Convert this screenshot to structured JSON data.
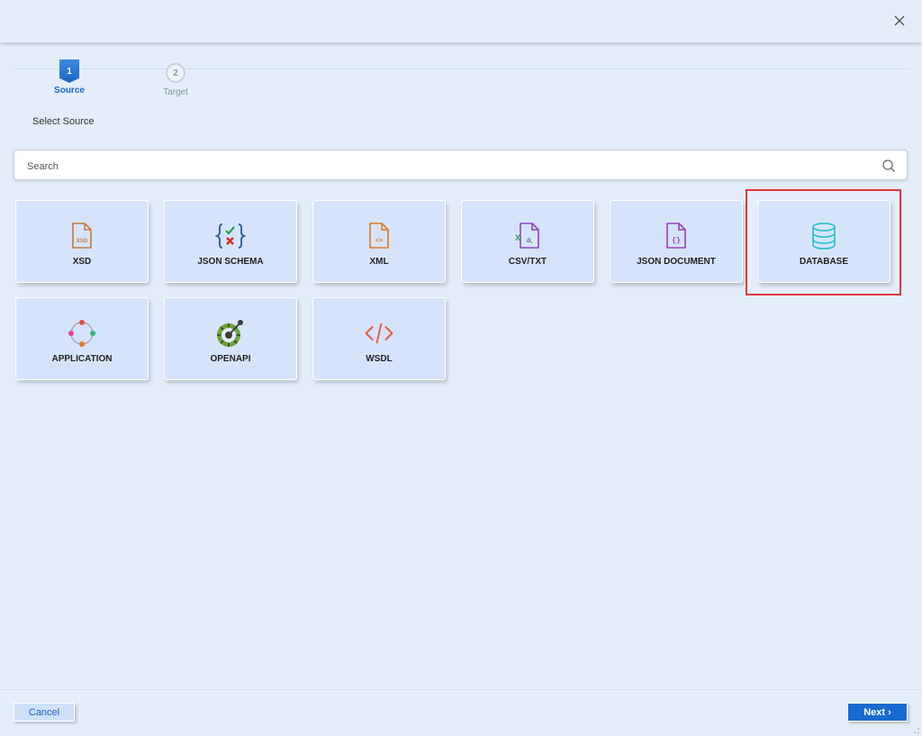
{
  "wizard": {
    "steps": [
      {
        "number": "1",
        "label": "Source",
        "state": "active"
      },
      {
        "number": "2",
        "label": "Target",
        "state": "inactive"
      }
    ],
    "section_title": "Select Source"
  },
  "search": {
    "placeholder": "Search"
  },
  "sources": [
    {
      "label": "XSD",
      "icon": "xsd-file-icon"
    },
    {
      "label": "JSON SCHEMA",
      "icon": "json-schema-icon"
    },
    {
      "label": "XML",
      "icon": "xml-file-icon"
    },
    {
      "label": "CSV/TXT",
      "icon": "csv-file-icon"
    },
    {
      "label": "JSON DOCUMENT",
      "icon": "json-document-icon"
    },
    {
      "label": "DATABASE",
      "icon": "database-icon",
      "highlighted": true
    },
    {
      "label": "APPLICATION",
      "icon": "application-icon"
    },
    {
      "label": "OPENAPI",
      "icon": "openapi-icon"
    },
    {
      "label": "WSDL",
      "icon": "wsdl-code-icon"
    }
  ],
  "footer": {
    "cancel_label": "Cancel",
    "next_label": "Next ›"
  },
  "colors": {
    "background": "#e3eefa",
    "card": "#d6e4fb",
    "accent": "#1a6bd0",
    "highlight": "#e0393e"
  }
}
